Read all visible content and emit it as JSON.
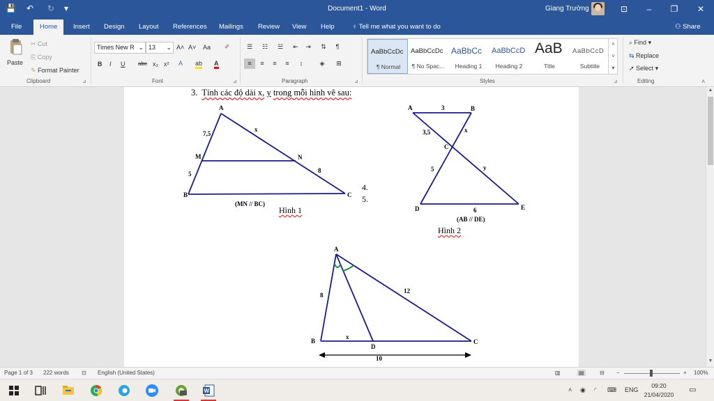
{
  "window": {
    "title": "Document1 - Word",
    "user_name": "Giang Trường",
    "buttons": {
      "minimize": "–",
      "restore": "❐",
      "close": "✕",
      "ribbon_display": "⊡"
    }
  },
  "quick_access": {
    "save": "💾",
    "undo": "↶",
    "redo": "↻",
    "customize": "▾"
  },
  "tabs": [
    {
      "label": "File"
    },
    {
      "label": "Home"
    },
    {
      "label": "Insert"
    },
    {
      "label": "Design"
    },
    {
      "label": "Layout"
    },
    {
      "label": "References"
    },
    {
      "label": "Mailings"
    },
    {
      "label": "Review"
    },
    {
      "label": "View"
    },
    {
      "label": "Help"
    }
  ],
  "tell_me": "Tell me what you want to do",
  "share": "Share",
  "ribbon": {
    "clipboard": {
      "paste": "Paste",
      "cut": "Cut",
      "copy": "Copy",
      "format_painter": "Format Painter",
      "label": "Clipboard"
    },
    "font": {
      "name": "Times New R",
      "size": "13",
      "grow": "A˄",
      "shrink": "A˅",
      "case": "Aa",
      "bold": "B",
      "italic": "I",
      "underline": "U",
      "strike": "abc",
      "sub": "x₂",
      "sup": "x²",
      "label": "Font"
    },
    "paragraph": {
      "label": "Paragraph"
    },
    "styles": {
      "label": "Styles",
      "items": [
        {
          "sample": "AaBbCcDc",
          "name": "¶ Normal"
        },
        {
          "sample": "AaBbCcDc",
          "name": "¶ No Spac..."
        },
        {
          "sample": "AaBbCc",
          "name": "Heading 1"
        },
        {
          "sample": "AaBbCcD",
          "name": "Heading 2"
        },
        {
          "sample": "AaB",
          "name": "Title"
        },
        {
          "sample": "AaBbCcD",
          "name": "Subtitle"
        }
      ]
    },
    "editing": {
      "find": "Find",
      "replace": "Replace",
      "select": "Select",
      "label": "Editing"
    }
  },
  "document": {
    "question": {
      "number": "3.",
      "text": "Tính các độ dài x,",
      "vars": "y",
      "text2": "trong mỗi hình vẽ sau:"
    },
    "figure1": {
      "vertices": {
        "A": "A",
        "M": "M",
        "N": "N",
        "B": "B",
        "C": "C"
      },
      "lengths": {
        "AM": "7,5",
        "AN": "x",
        "MB": "5",
        "NC": "8"
      },
      "note": "(MN // BC)",
      "caption": "Hình 1"
    },
    "list_items": [
      "4.",
      "5."
    ],
    "figure2": {
      "vertices": {
        "A": "A",
        "B": "B",
        "C": "C",
        "D": "D",
        "E": "E"
      },
      "lengths": {
        "AB": "3",
        "BC": "x",
        "AC": "3,5",
        "CD": "5",
        "CE": "y",
        "DE": "6"
      },
      "note": "(AB // DE)",
      "caption": "Hình 2"
    },
    "figure3": {
      "vertices": {
        "A": "A",
        "B": "B",
        "C": "C",
        "D": "D"
      },
      "lengths": {
        "AB": "8",
        "AC": "12",
        "BD": "x",
        "BC": "10"
      }
    }
  },
  "status": {
    "page": "Page 1 of 3",
    "words": "222 words",
    "language": "English (United States)",
    "zoom": "100%"
  },
  "taskbar": {
    "language": "ENG",
    "time": "09:20",
    "date": "21/04/2020"
  }
}
